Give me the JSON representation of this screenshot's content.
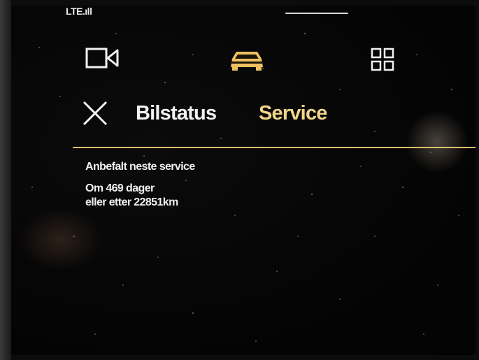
{
  "status_bar": {
    "network": "LTE.ıll"
  },
  "nav": {
    "icons": [
      "camera-icon",
      "car-icon",
      "apps-grid-icon"
    ],
    "active_color": "#f0c060"
  },
  "tabs": [
    {
      "label": "Bilstatus",
      "active": false
    },
    {
      "label": "Service",
      "active": true
    }
  ],
  "colors": {
    "accent": "#f0d58a",
    "text": "#f0f0f0",
    "background": "#050505"
  },
  "service": {
    "heading": "Anbefalt neste service",
    "days_line": "Om 469 dager",
    "km_line": "eller etter 22851km"
  }
}
